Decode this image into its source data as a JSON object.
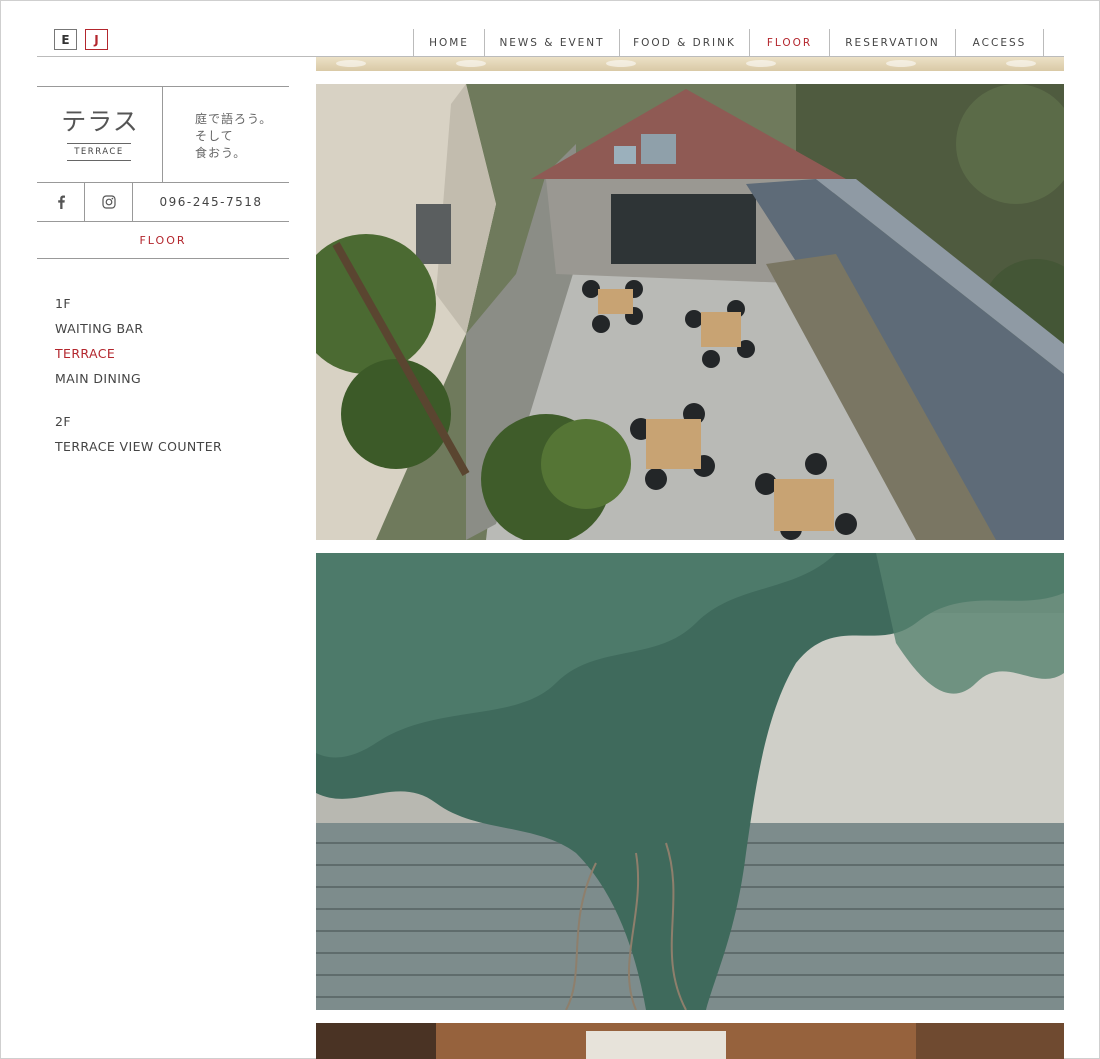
{
  "language": {
    "options": [
      {
        "label": "E",
        "active": false
      },
      {
        "label": "J",
        "active": true
      }
    ]
  },
  "nav": {
    "items": [
      {
        "label": "HOME",
        "active": false
      },
      {
        "label": "NEWS & EVENT",
        "active": false
      },
      {
        "label": "FOOD & DRINK",
        "active": false
      },
      {
        "label": "FLOOR",
        "active": true
      },
      {
        "label": "RESERVATION",
        "active": false
      },
      {
        "label": "ACCESS",
        "active": false
      }
    ]
  },
  "brand": {
    "logo_jp": "テラス",
    "logo_en": "TERRACE",
    "tagline": [
      "庭で語ろう。",
      "そして",
      "食おう。"
    ]
  },
  "contact": {
    "facebook_icon": "facebook-icon",
    "instagram_icon": "instagram-icon",
    "phone": "096-245-7518"
  },
  "section_label": "FLOOR",
  "floor_menu": {
    "groups": [
      {
        "heading": "1F",
        "items": [
          {
            "label": "WAITING BAR",
            "active": false
          },
          {
            "label": "TERRACE",
            "active": true
          },
          {
            "label": "MAIN DINING",
            "active": false
          }
        ]
      },
      {
        "heading": "2F",
        "items": [
          {
            "label": "TERRACE VIEW COUNTER",
            "active": false
          }
        ]
      }
    ]
  },
  "colors": {
    "accent": "#b3262d",
    "text": "#444444",
    "rule": "#999999"
  }
}
